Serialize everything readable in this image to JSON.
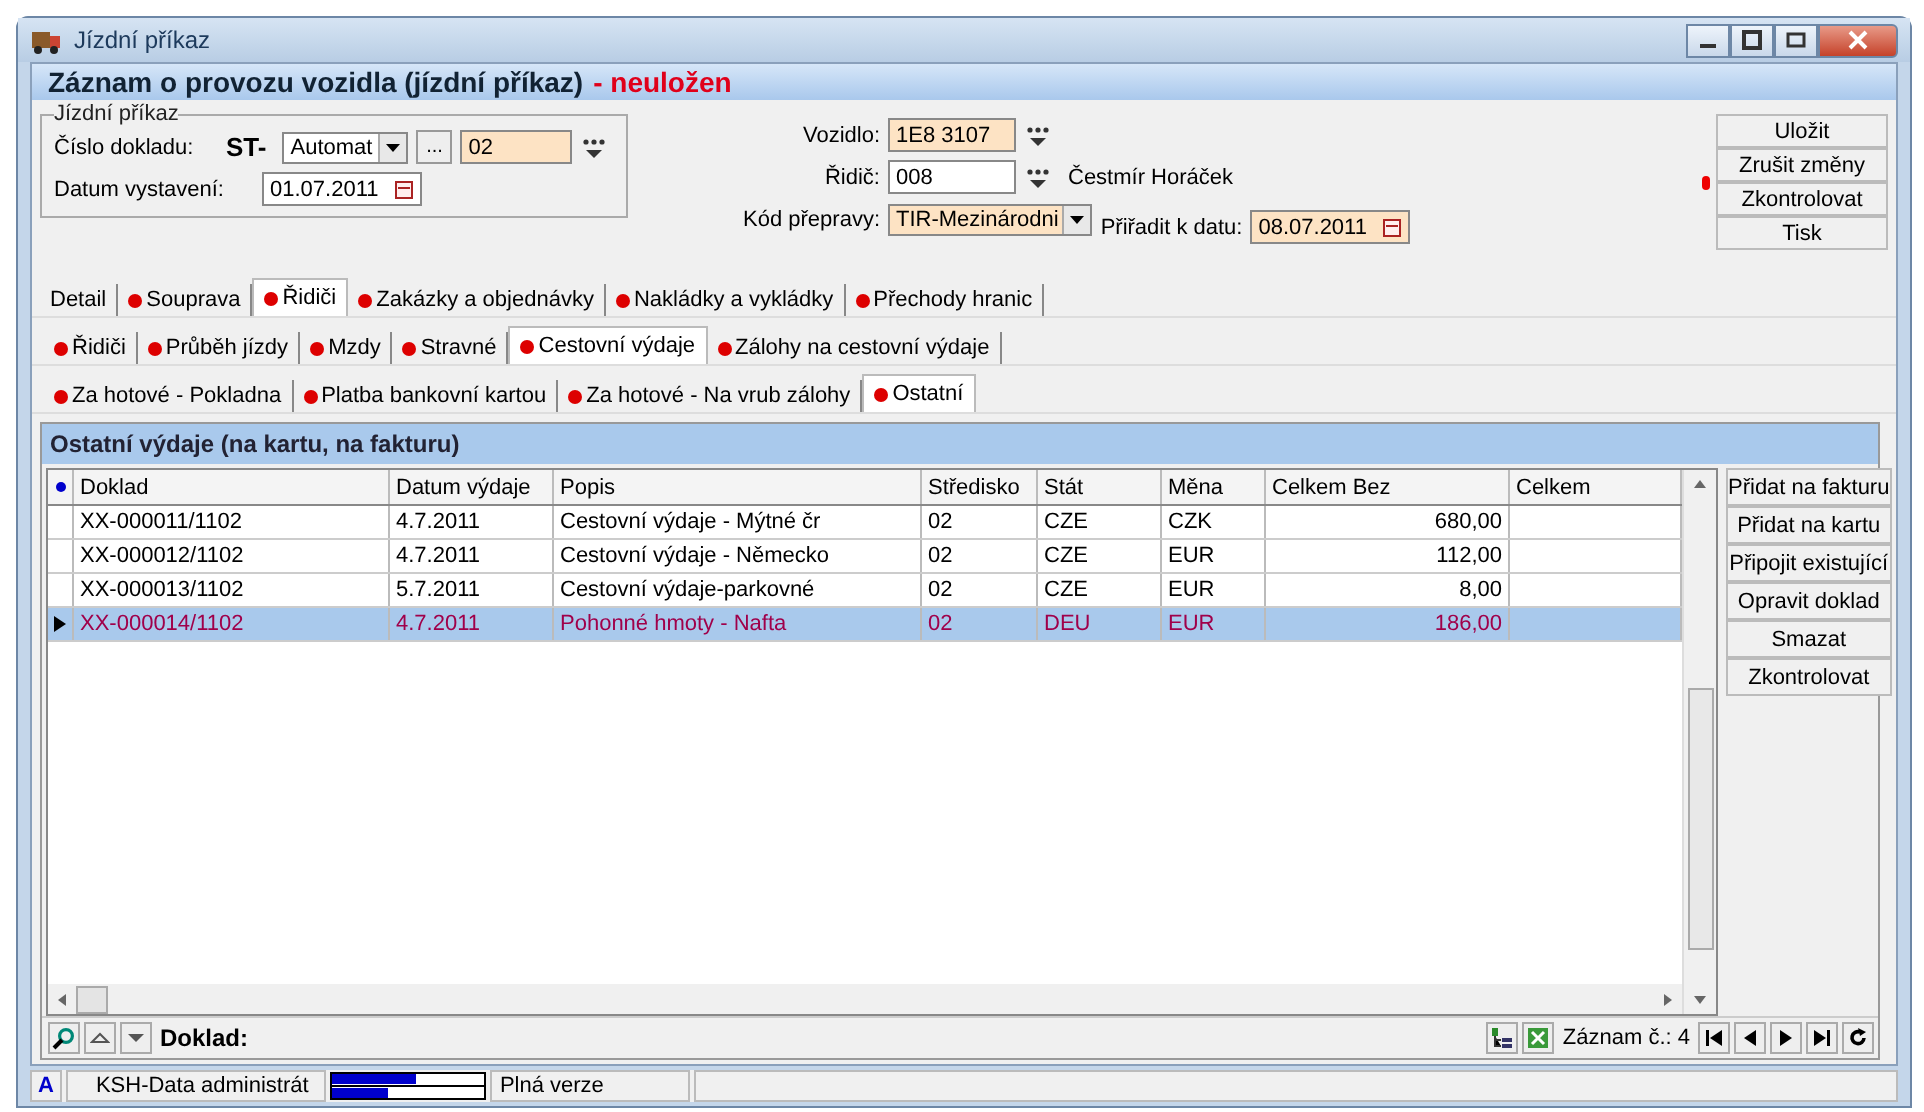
{
  "window": {
    "title": "Jízdní příkaz"
  },
  "header": {
    "title": "Záznam o provozu vozidla (jízdní příkaz)",
    "status": "- neuložen"
  },
  "form": {
    "group_title": "Jízdní příkaz",
    "number_label": "Číslo dokladu:",
    "prefix": "ST-",
    "series": "Automat",
    "ellipsis": "...",
    "number": "02",
    "date_label": "Datum vystavení:",
    "date": "01.07.2011",
    "vehicle_label": "Vozidlo:",
    "vehicle": "1E8 3107",
    "driver_label": "Řidič:",
    "driver": "008",
    "driver_name": "Čestmír Horáček",
    "transport_label": "Kód přepravy:",
    "transport": "TIR-Mezinárodni",
    "assign_label": "Přiřadit k datu:",
    "assign_date": "08.07.2011"
  },
  "actions": [
    "Uložit",
    "Zrušit změny",
    "Zkontrolovat",
    "Tisk"
  ],
  "tab_rows": [
    [
      {
        "label": "Detail",
        "dot": false,
        "selected": false
      },
      {
        "label": "Souprava",
        "dot": true,
        "selected": false
      },
      {
        "label": "Řidiči",
        "dot": true,
        "selected": true
      },
      {
        "label": "Zakázky a objednávky",
        "dot": true,
        "selected": false
      },
      {
        "label": "Nakládky a vykládky",
        "dot": true,
        "selected": false
      },
      {
        "label": "Přechody hranic",
        "dot": true,
        "selected": false
      }
    ],
    [
      {
        "label": "Řidiči",
        "dot": true,
        "selected": false
      },
      {
        "label": "Průběh jízdy",
        "dot": true,
        "selected": false
      },
      {
        "label": "Mzdy",
        "dot": true,
        "selected": false
      },
      {
        "label": "Stravné",
        "dot": true,
        "selected": false
      },
      {
        "label": "Cestovní výdaje",
        "dot": true,
        "selected": true
      },
      {
        "label": "Zálohy na cestovní výdaje",
        "dot": true,
        "selected": false
      }
    ],
    [
      {
        "label": "Za hotové - Pokladna",
        "dot": true,
        "selected": false
      },
      {
        "label": "Platba bankovní kartou",
        "dot": true,
        "selected": false
      },
      {
        "label": "Za hotové - Na vrub zálohy",
        "dot": true,
        "selected": false
      },
      {
        "label": "Ostatní",
        "dot": true,
        "selected": true
      }
    ]
  ],
  "grid": {
    "title": "Ostatní výdaje (na kartu, na fakturu)",
    "columns": [
      "Doklad",
      "Datum výdaje",
      "Popis",
      "Středisko",
      "Stát",
      "Měna",
      "Celkem Bez",
      "Celkem"
    ],
    "rows": [
      {
        "cells": [
          "XX-000011/1102",
          "4.7.2011",
          "Cestovní výdaje - Mýtné čr",
          "02",
          "CZE",
          "CZK",
          "680,00",
          ""
        ],
        "selected": false
      },
      {
        "cells": [
          "XX-000012/1102",
          "4.7.2011",
          "Cestovní výdaje - Německo",
          "02",
          "CZE",
          "EUR",
          "112,00",
          ""
        ],
        "selected": false
      },
      {
        "cells": [
          "XX-000013/1102",
          "5.7.2011",
          "Cestovní výdaje-parkovné",
          "02",
          "CZE",
          "EUR",
          "8,00",
          ""
        ],
        "selected": false
      },
      {
        "cells": [
          "XX-000014/1102",
          "4.7.2011",
          "Pohonné hmoty - Nafta",
          "02",
          "DEU",
          "EUR",
          "186,00",
          ""
        ],
        "selected": true
      }
    ]
  },
  "side_buttons": [
    "Přidat na fakturu",
    "Přidat na kartu",
    "Připojit existující",
    "Opravit doklad",
    "Smazat",
    "Zkontrolovat"
  ],
  "navigator": {
    "label": "Doklad:",
    "record": "Záznam č.: 4"
  },
  "status_bar": {
    "mode": "A",
    "user": "KSH-Data administrát",
    "edition": "Plná verze"
  }
}
